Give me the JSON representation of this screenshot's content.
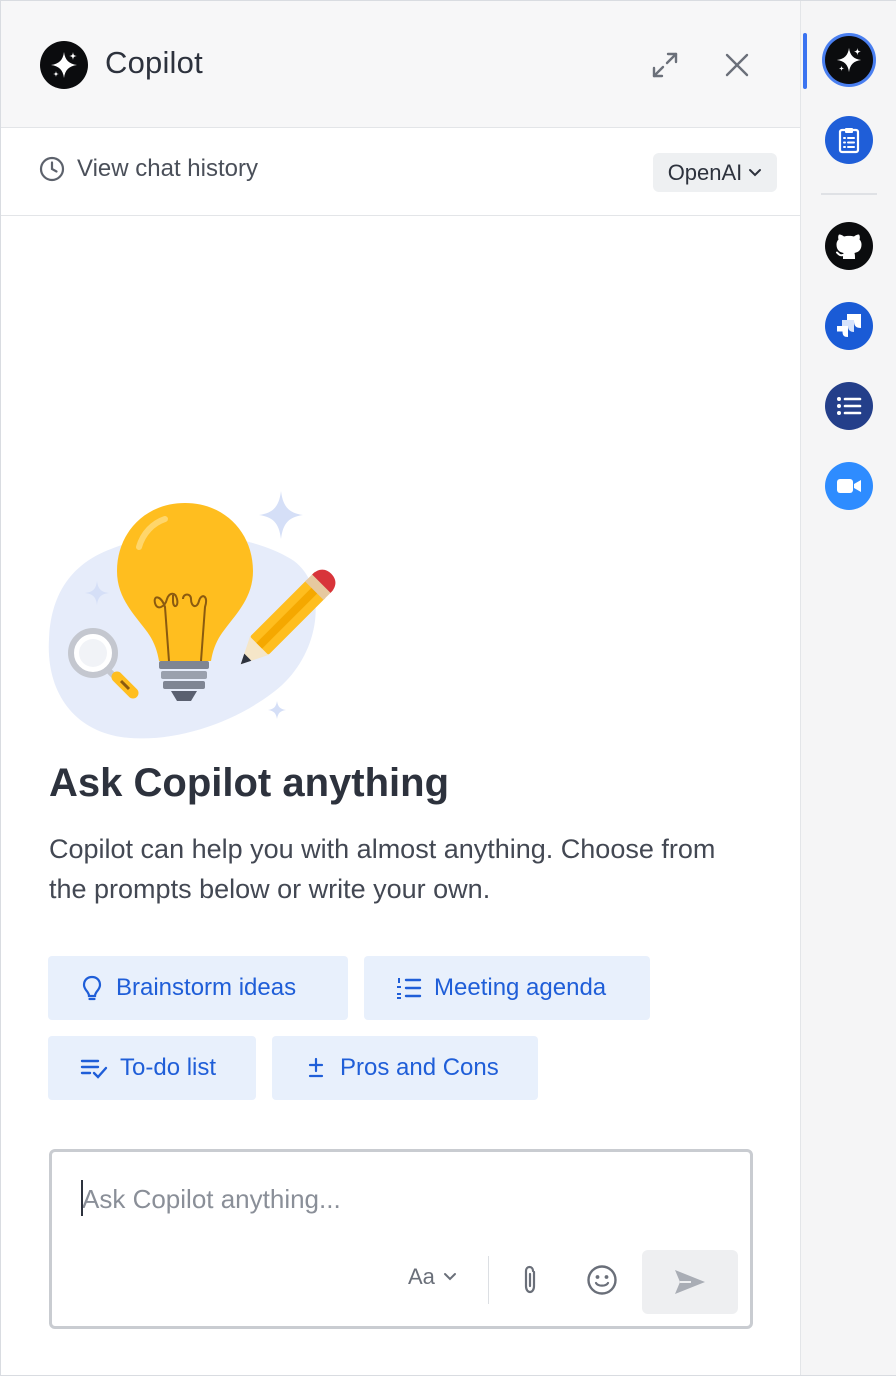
{
  "header": {
    "title": "Copilot",
    "logo_icon": "sparkle-icon",
    "expand_icon": "expand-arrows-icon",
    "close_icon": "close-icon"
  },
  "subbar": {
    "history_label": "View chat history",
    "history_icon": "clock-icon",
    "model_label": "OpenAI",
    "model_icon": "chevron-down-icon"
  },
  "empty_state": {
    "illustration": "lightbulb-pencil-magnifier-illustration",
    "heading": "Ask Copilot anything",
    "description": "Copilot can help you with almost anything. Choose from the prompts below or write your own."
  },
  "prompts": [
    {
      "label": "Brainstorm ideas",
      "icon": "lightbulb-icon"
    },
    {
      "label": "Meeting agenda",
      "icon": "numbered-list-icon"
    },
    {
      "label": "To-do list",
      "icon": "checklist-icon"
    },
    {
      "label": "Pros and Cons",
      "icon": "plus-minus-icon"
    }
  ],
  "composer": {
    "placeholder": "Ask Copilot anything...",
    "value": "",
    "format_label": "Aa",
    "attach_icon": "paperclip-icon",
    "emoji_icon": "smiley-icon",
    "send_icon": "send-icon"
  },
  "rail": {
    "items": [
      {
        "name": "copilot",
        "icon": "sparkle-icon",
        "active": true
      },
      {
        "name": "clipboard",
        "icon": "clipboard-icon"
      },
      {
        "name": "github",
        "icon": "github-icon"
      },
      {
        "name": "jira",
        "icon": "jira-icon"
      },
      {
        "name": "list",
        "icon": "list-icon"
      },
      {
        "name": "zoom",
        "icon": "video-camera-icon"
      }
    ]
  },
  "colors": {
    "accent": "#1f5ed8",
    "chip_bg": "#e8f0fc",
    "text": "#2d323d"
  }
}
